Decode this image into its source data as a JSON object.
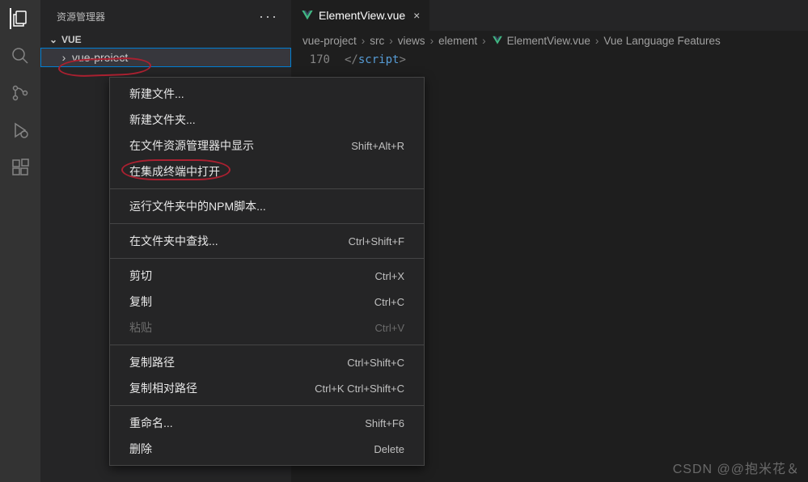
{
  "activityBar": {
    "explorer": "explorer",
    "search": "search",
    "sourceControl": "source-control",
    "debug": "run-debug",
    "extensions": "extensions"
  },
  "sidebar": {
    "title": "资源管理器",
    "rootFolder": "VUE",
    "selectedFolder": "vue-proiect"
  },
  "tab": {
    "filename": "ElementView.vue",
    "closeGlyph": "×"
  },
  "breadcrumb": {
    "parts": [
      "vue-project",
      "src",
      "views",
      "element",
      "ElementView.vue",
      "Vue Language Features"
    ],
    "sep": "›"
  },
  "code": {
    "line_num": "170",
    "tag_open": "</",
    "tag_name": "script",
    "tag_close": ">"
  },
  "contextMenu": {
    "items": [
      {
        "label": "新建文件...",
        "shortcut": ""
      },
      {
        "label": "新建文件夹...",
        "shortcut": ""
      },
      {
        "label": "在文件资源管理器中显示",
        "shortcut": "Shift+Alt+R"
      },
      {
        "label": "在集成终端中打开",
        "shortcut": ""
      },
      "sep",
      {
        "label": "运行文件夹中的NPM脚本...",
        "shortcut": ""
      },
      "sep",
      {
        "label": "在文件夹中查找...",
        "shortcut": "Ctrl+Shift+F"
      },
      "sep",
      {
        "label": "剪切",
        "shortcut": "Ctrl+X"
      },
      {
        "label": "复制",
        "shortcut": "Ctrl+C"
      },
      {
        "label": "粘贴",
        "shortcut": "Ctrl+V",
        "disabled": true
      },
      "sep",
      {
        "label": "复制路径",
        "shortcut": "Ctrl+Shift+C"
      },
      {
        "label": "复制相对路径",
        "shortcut": "Ctrl+K Ctrl+Shift+C"
      },
      "sep",
      {
        "label": "重命名...",
        "shortcut": "Shift+F6"
      },
      {
        "label": "删除",
        "shortcut": "Delete"
      }
    ]
  },
  "watermark": "CSDN @@抱米花＆"
}
